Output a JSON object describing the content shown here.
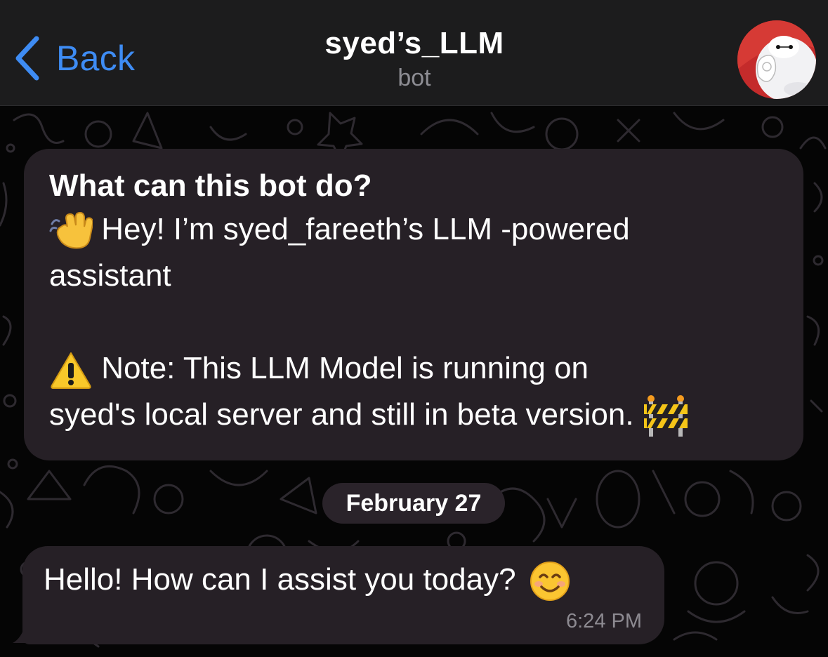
{
  "header": {
    "back_label": "Back",
    "title": "syed’s_LLM",
    "subtitle": "bot",
    "avatar_icon": "robot-avatar-icon",
    "accent_color": "#3e8cf4"
  },
  "info": {
    "heading": "What can this bot do?",
    "wave_icon": "waving-hand-emoji",
    "line1": "Hey! I’m syed_fareeth’s LLM -powered",
    "line2": "assistant",
    "warning_icon": "warning-emoji",
    "line3": "Note: This LLM Model is running on",
    "line4": "syed's local server and still in beta version.",
    "construction_icon": "construction-emoji"
  },
  "date_separator": "February 27",
  "messages": [
    {
      "text": "Hello! How can I assist you today?",
      "emoji_icon": "smiling-face-emoji",
      "time": "6:24 PM"
    }
  ]
}
